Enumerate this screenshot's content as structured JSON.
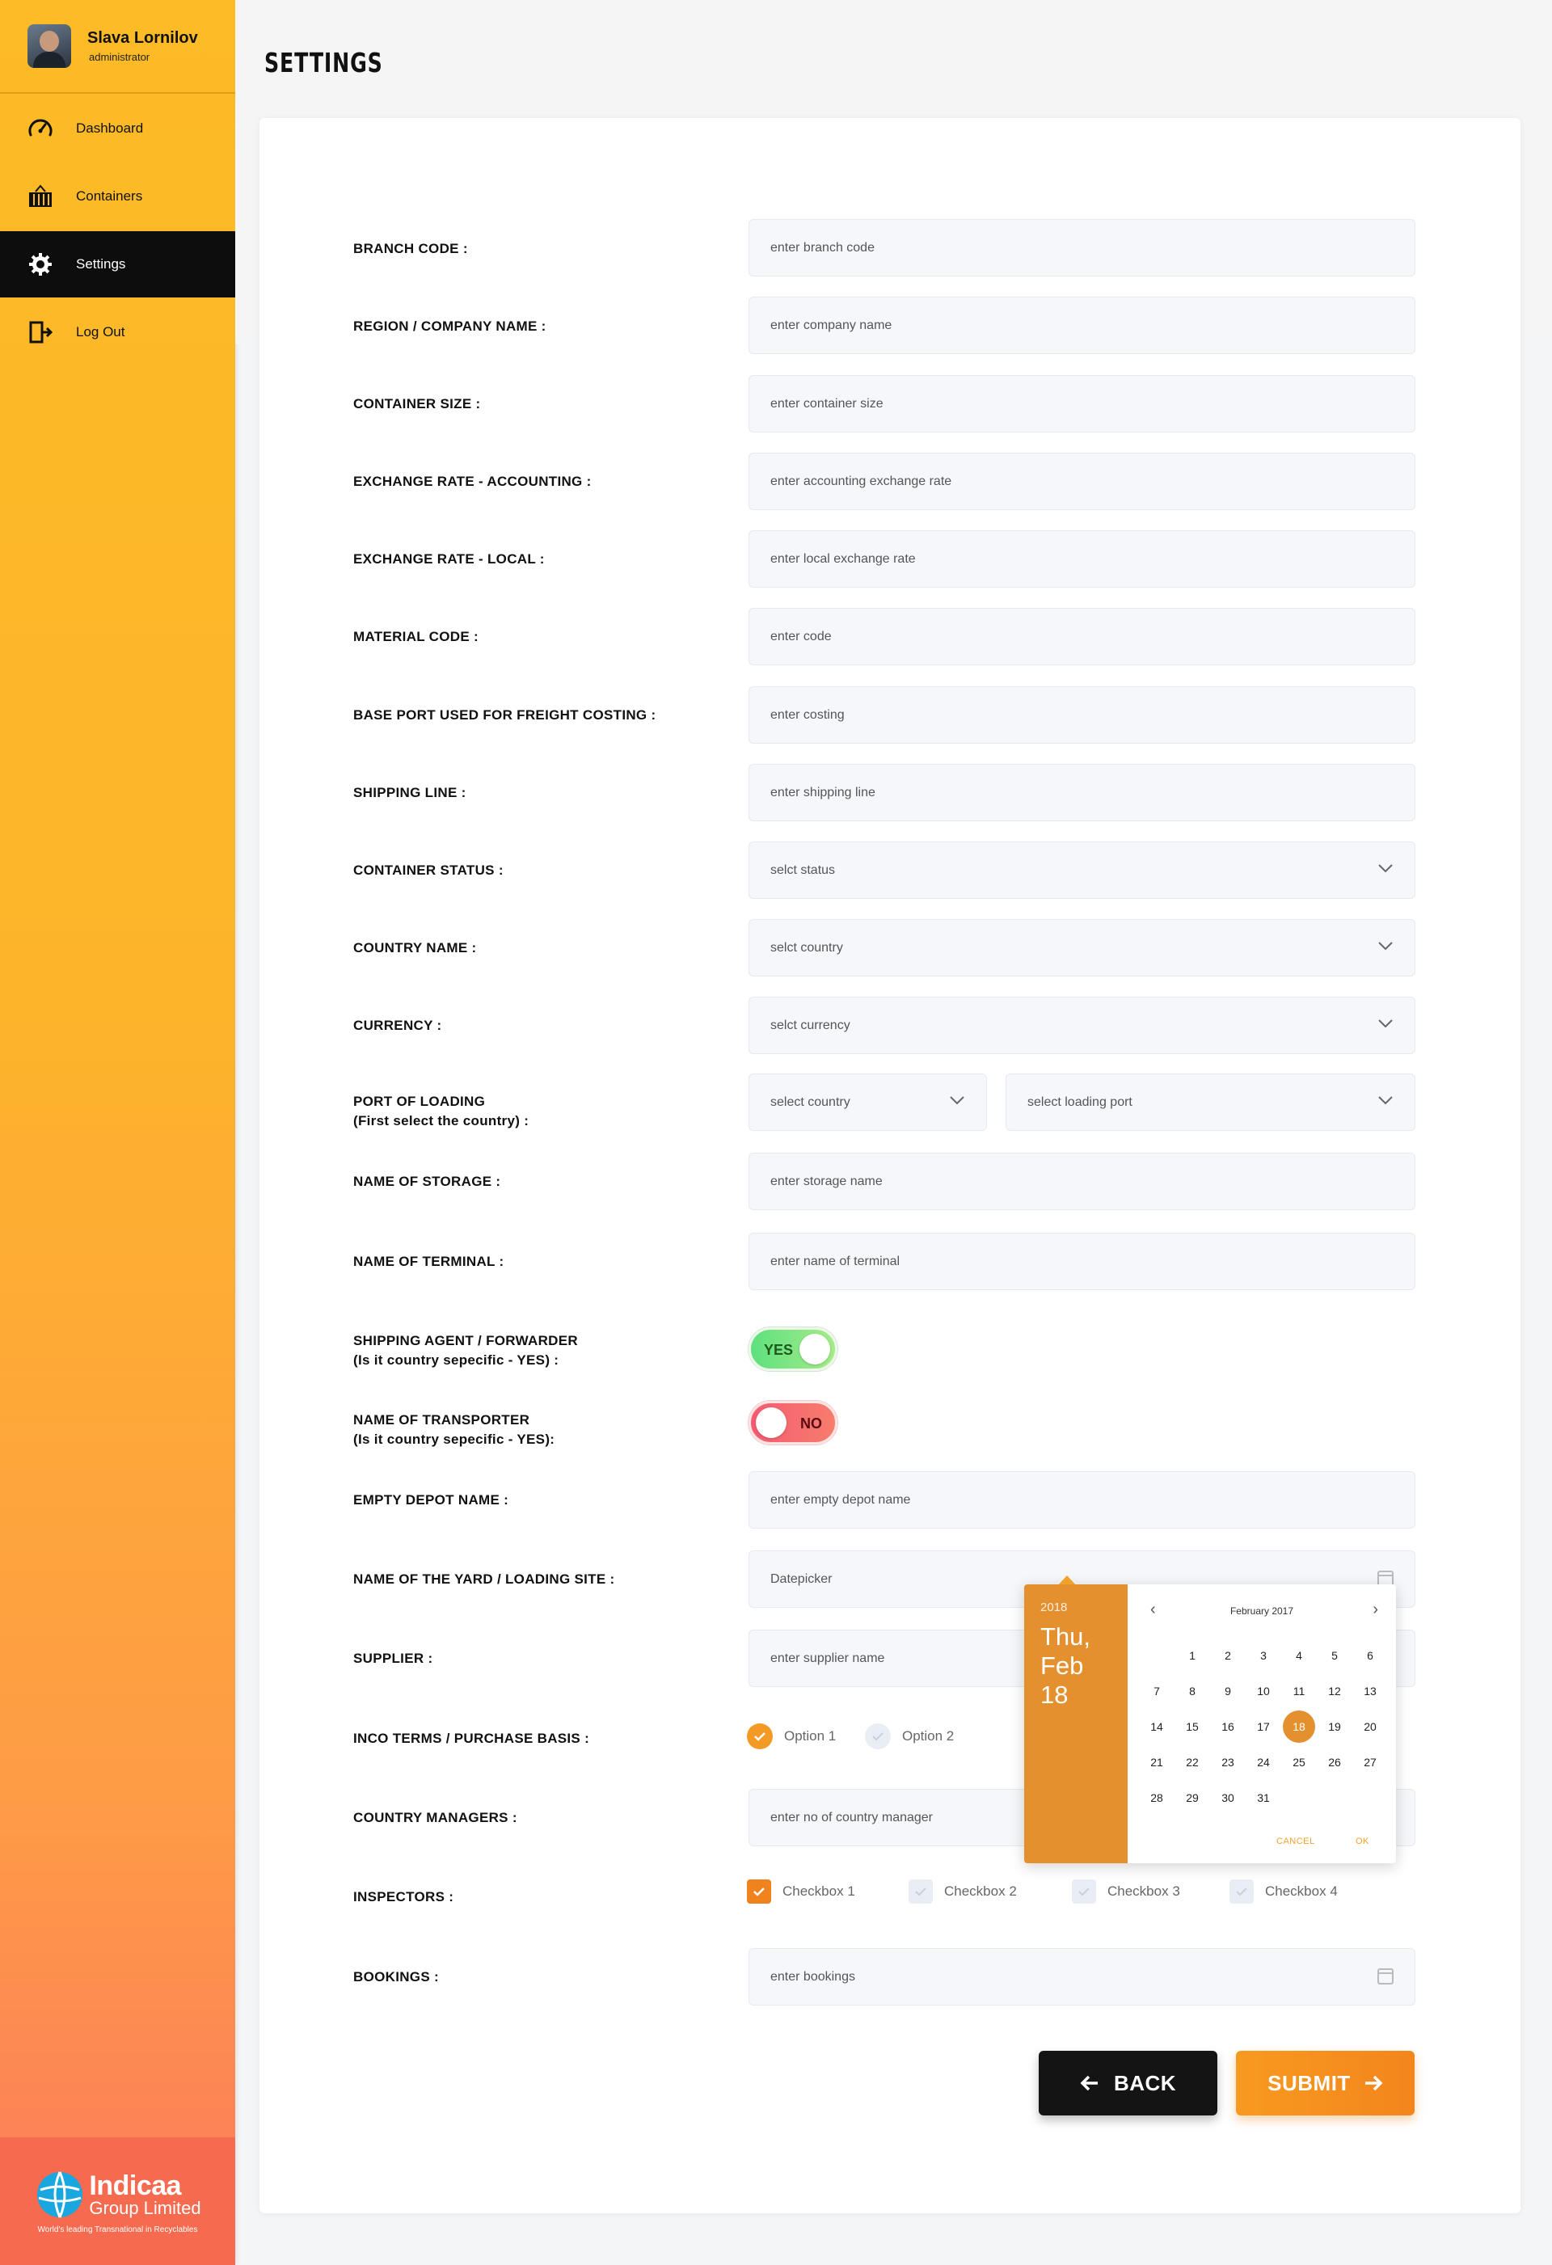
{
  "user": {
    "name": "Slava Lornilov",
    "role": "administrator"
  },
  "nav": [
    {
      "label": "Dashboard",
      "icon": "speedometer-icon"
    },
    {
      "label": "Containers",
      "icon": "container-icon"
    },
    {
      "label": "Settings",
      "icon": "gear-icon",
      "active": true
    },
    {
      "label": "Log Out",
      "icon": "logout-icon"
    }
  ],
  "brand": {
    "line1": "Indicaa",
    "line2": "Group Limited",
    "tagline": "World's leading Transnational in Recyclables",
    "color": "#f66a4f"
  },
  "page": {
    "title": "SETTINGS"
  },
  "form": {
    "branch_code": {
      "label": "BRANCH CODE :",
      "placeholder": "enter branch code"
    },
    "company_name": {
      "label": "REGION / COMPANY NAME :",
      "placeholder": "enter company name"
    },
    "container_size": {
      "label": "CONTAINER SIZE :",
      "placeholder": "enter container size"
    },
    "rate_accounting": {
      "label": "EXCHANGE RATE - ACCOUNTING  :",
      "placeholder": "enter accounting exchange rate"
    },
    "rate_local": {
      "label": "EXCHANGE RATE - LOCAL :",
      "placeholder": "enter local exchange rate"
    },
    "material_code": {
      "label": "MATERIAL CODE :",
      "placeholder": "enter code"
    },
    "base_port": {
      "label": "BASE PORT USED FOR FREIGHT COSTING :",
      "placeholder": "enter costing"
    },
    "shipping_line": {
      "label": "SHIPPING LINE :",
      "placeholder": "enter shipping line"
    },
    "container_status": {
      "label": "CONTAINER STATUS  :",
      "placeholder": "selct status"
    },
    "country_name": {
      "label": "COUNTRY NAME :",
      "placeholder": "selct country"
    },
    "currency": {
      "label": "CURRENCY :",
      "placeholder": "selct currency"
    },
    "port_loading": {
      "label_1": "PORT OF LOADING",
      "label_2": "(First select the country) :",
      "country_placeholder": "select country",
      "port_placeholder": "select loading port"
    },
    "storage": {
      "label": "NAME OF STORAGE :",
      "placeholder": "enter storage name"
    },
    "terminal": {
      "label": "NAME OF TERMINAL :",
      "placeholder": "enter name of terminal"
    },
    "shipping_agent": {
      "label_1": "SHIPPING AGENT / FORWARDER",
      "label_2": "(Is it country sepecific - YES) :",
      "value": "YES",
      "on": true
    },
    "transporter": {
      "label_1": "NAME OF TRANSPORTER",
      "label_2": "(Is it country sepecific - YES):",
      "value": "NO",
      "on": false
    },
    "empty_depot": {
      "label": "EMPTY DEPOT NAME :",
      "placeholder": "enter empty depot name"
    },
    "yard": {
      "label": "NAME OF THE YARD / LOADING SITE :",
      "placeholder": "Datepicker"
    },
    "supplier": {
      "label": "SUPPLIER :",
      "placeholder": "enter supplier name"
    },
    "inco_terms": {
      "label": "INCO TERMS / PURCHASE BASIS :",
      "options": [
        {
          "label": "Option 1",
          "checked": true
        },
        {
          "label": "Option 2",
          "checked": false
        }
      ]
    },
    "country_managers": {
      "label": "COUNTRY MANAGERS :",
      "placeholder": "enter no of country manager"
    },
    "inspectors": {
      "label": "INSPECTORS :",
      "options": [
        {
          "label": "Checkbox 1",
          "checked": true
        },
        {
          "label": "Checkbox 2",
          "checked": false
        },
        {
          "label": "Checkbox 3",
          "checked": false
        },
        {
          "label": "Checkbox 4",
          "checked": false
        }
      ]
    },
    "bookings": {
      "label": "BOOKINGS :",
      "placeholder": "enter bookings"
    }
  },
  "buttons": {
    "back": "BACK",
    "submit": "SUBMIT"
  },
  "datepicker": {
    "year": "2018",
    "weekday": "Thu,",
    "date": "Feb 18",
    "month_title": "February 2017",
    "prev": "‹",
    "next": "›",
    "weeks": [
      [
        "",
        "1",
        "2",
        "3",
        "4",
        "5",
        "6"
      ],
      [
        "7",
        "8",
        "9",
        "10",
        "11",
        "12",
        "13"
      ],
      [
        "14",
        "15",
        "16",
        "17",
        "18",
        "19",
        "20"
      ],
      [
        "21",
        "22",
        "23",
        "24",
        "25",
        "26",
        "27"
      ],
      [
        "28",
        "29",
        "30",
        "31",
        "",
        "",
        ""
      ]
    ],
    "selected": "18",
    "cancel": "CANCEL",
    "ok": "OK",
    "accent": "#e4902f"
  },
  "colors": {
    "sidebar_top": "#fdbb26",
    "sidebar_bottom": "#fc7a5c",
    "accent": "#f3851d",
    "toggle_yes": "#5ee07e",
    "toggle_no": "#f55b72"
  }
}
